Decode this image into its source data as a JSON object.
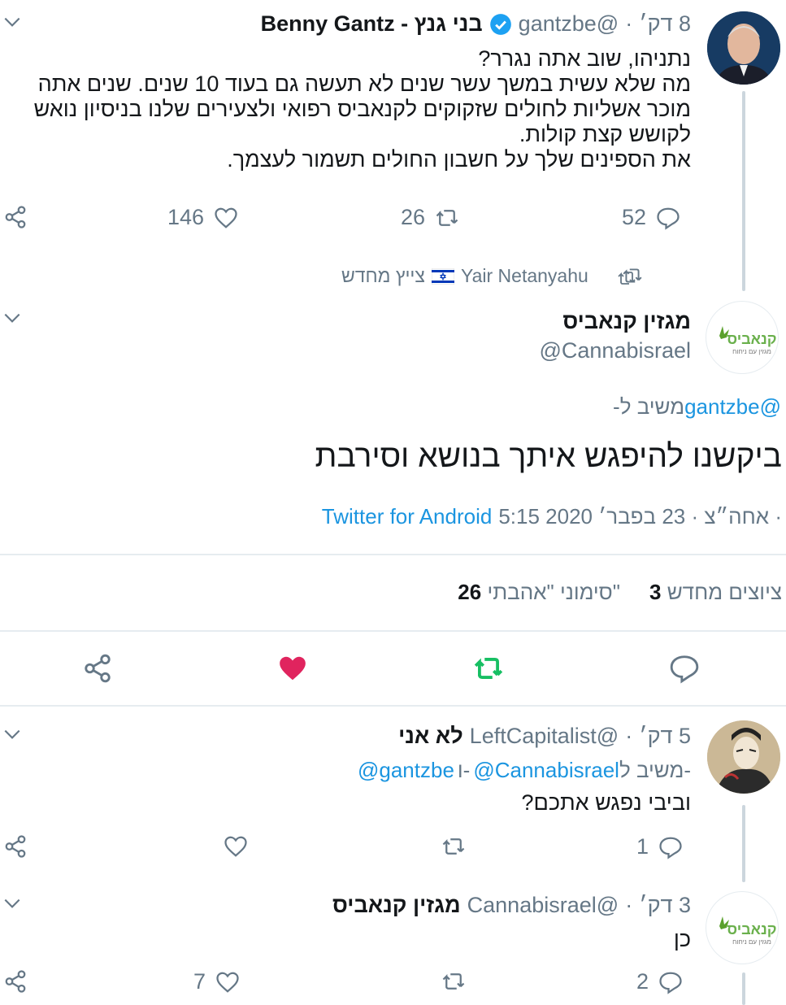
{
  "tweet1": {
    "display_name": "בני גנץ - Benny Gantz",
    "handle": "@gantzbe",
    "time": "8 דק׳",
    "text_lines": [
      "נתניהו, שוב אתה נגרר?",
      "מה שלא עשית במשך עשר שנים לא תעשה גם בעוד 10 שנים. שנים אתה",
      "מוכר אשליות לחולים שזקוקים לקנאביס רפואי ולצעירים שלנו בניסיון נואש",
      "לקושש קצת קולות.",
      "את הספינים שלך על חשבון החולים תשמור לעצמך."
    ],
    "replies": "52",
    "retweets": "26",
    "likes": "146"
  },
  "retweet_context": {
    "name": "Yair Netanyahu",
    "action": "צייץ מחדש"
  },
  "main_tweet": {
    "display_name": "מגזין קנאביס",
    "handle": "@Cannabisrael",
    "avatar_text": "קנאביס",
    "avatar_subtext": "מגזין עם ניחוח",
    "replying_prefix": "משיב ל-",
    "replying_to": "@gantzbe",
    "text": "ביקשנו להיפגש איתך בנושא וסירבת",
    "timestamp": "5:15 אחה״צ · 23 בפבר׳ 2020 ·",
    "source": "Twitter for Android",
    "retweets_count": "3",
    "retweets_label": "ציוצים מחדש",
    "likes_count": "26",
    "likes_label": "סימוני \"אהבתי\""
  },
  "reply1": {
    "display_name": "לא אני",
    "handle": "@LeftCapitalist",
    "time": "5 דק׳",
    "replying_prefix": "משיב ל-",
    "replying_to_1": "@Cannabisrael",
    "replying_join": "ו-",
    "replying_to_2": "@gantzbe",
    "text": "וביבי נפגש אתכם?",
    "replies": "1",
    "retweets": "",
    "likes": ""
  },
  "reply2": {
    "display_name": "מגזין קנאביס",
    "handle": "@Cannabisrael",
    "time": "3 דק׳",
    "text": "כן",
    "replies": "2",
    "retweets": "",
    "likes": "7"
  },
  "colors": {
    "like_red": "#e0245e",
    "retweet_green": "#17bf63",
    "link_blue": "#1b95e0",
    "muted_gray": "#657786",
    "verified_blue": "#1da1f2"
  }
}
